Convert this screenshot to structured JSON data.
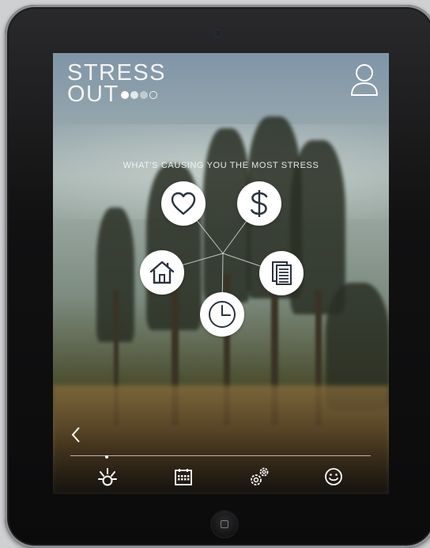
{
  "app": {
    "logo_line1": "STRESS",
    "logo_line2": "OUT"
  },
  "header": {
    "profile_icon": "user-icon"
  },
  "main": {
    "question": "WHAT'S CAUSING YOU THE MOST STRESS",
    "options": [
      {
        "id": "relationships",
        "icon": "heart-icon"
      },
      {
        "id": "money",
        "icon": "dollar-icon"
      },
      {
        "id": "home",
        "icon": "house-icon"
      },
      {
        "id": "work",
        "icon": "document-icon"
      },
      {
        "id": "time",
        "icon": "clock-icon"
      }
    ]
  },
  "footer": {
    "back_icon": "chevron-left-icon",
    "tabs": [
      {
        "id": "stress",
        "icon": "stress-burst-icon",
        "selected": true
      },
      {
        "id": "calendar",
        "icon": "calendar-icon",
        "selected": false
      },
      {
        "id": "settings",
        "icon": "gears-icon",
        "selected": false
      },
      {
        "id": "mood",
        "icon": "smiley-icon",
        "selected": false
      }
    ]
  },
  "colors": {
    "circle_fill": "#ffffff",
    "icon_stroke": "#2b3240",
    "text_light": "#f2f4f4"
  }
}
